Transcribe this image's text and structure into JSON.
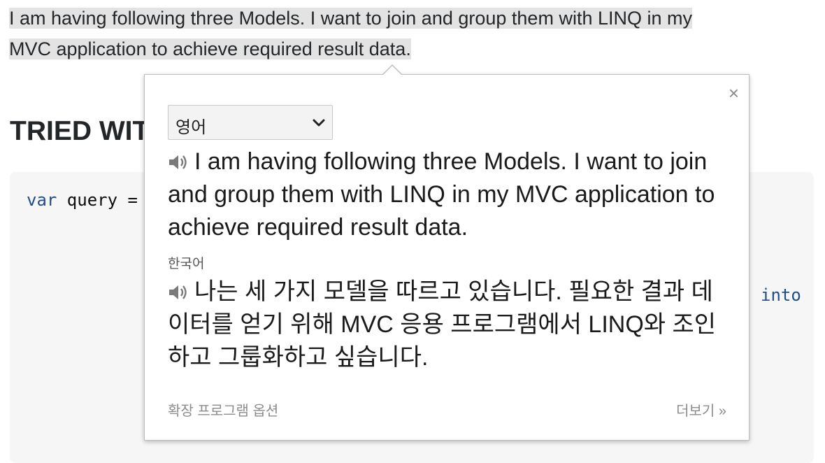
{
  "question": {
    "intro_line1": "I am having following three Models. I want to join and group them with LINQ in my",
    "intro_line2": "MVC application to achieve required result data.",
    "heading": "TRIED WIT"
  },
  "code": {
    "line1_keyword": "var",
    "line1_rest": " query =",
    "into_keyword": "into"
  },
  "popup": {
    "close_label": "×",
    "source_language": "영어",
    "source_text": "I am having following three Models. I want to join and group them with LINQ in my MVC application to achieve required result data.",
    "target_language": "한국어",
    "target_text": "나는 세 가지 모델을 따르고 있습니다. 필요한 결과 데이터를 얻기 위해 MVC 응용 프로그램에서 LINQ와 조인하고 그룹화하고 싶습니다.",
    "extension_options_label": "확장 프로그램 옵션",
    "more_label": "더보기 »"
  },
  "icons": {
    "speaker": "speaker-icon",
    "close": "close-icon",
    "dropdown": "chevron-down-icon"
  }
}
